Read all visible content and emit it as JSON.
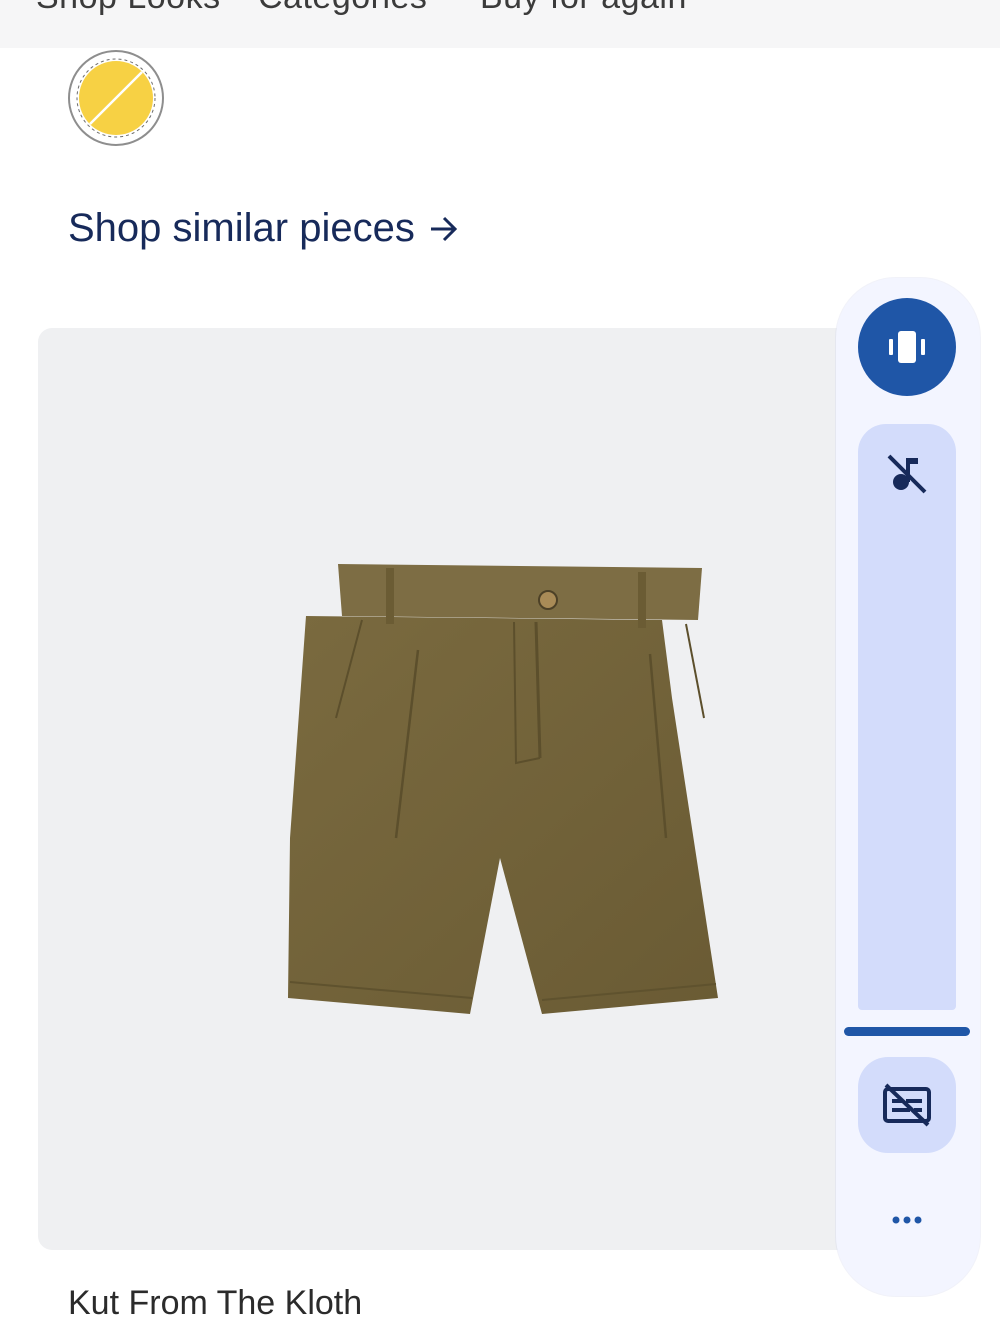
{
  "top_tabs": {
    "items": [
      "Shop Looks",
      "Categories",
      "Buy for again"
    ]
  },
  "shop_similar": {
    "label": "Shop similar pieces",
    "icon": "arrow-right-icon"
  },
  "product": {
    "brand": "Kut From The Kloth",
    "image": "olive-pleated-shorts",
    "swatch_color": "#f7d144"
  },
  "volume_panel": {
    "vibrate_icon": "vibrate-icon",
    "mute_icon": "music-off-icon",
    "captions_icon": "captions-off-icon",
    "more_icon": "more-horizontal-icon",
    "accent_color": "#1f56a7",
    "track_color": "#d3dcfb"
  }
}
